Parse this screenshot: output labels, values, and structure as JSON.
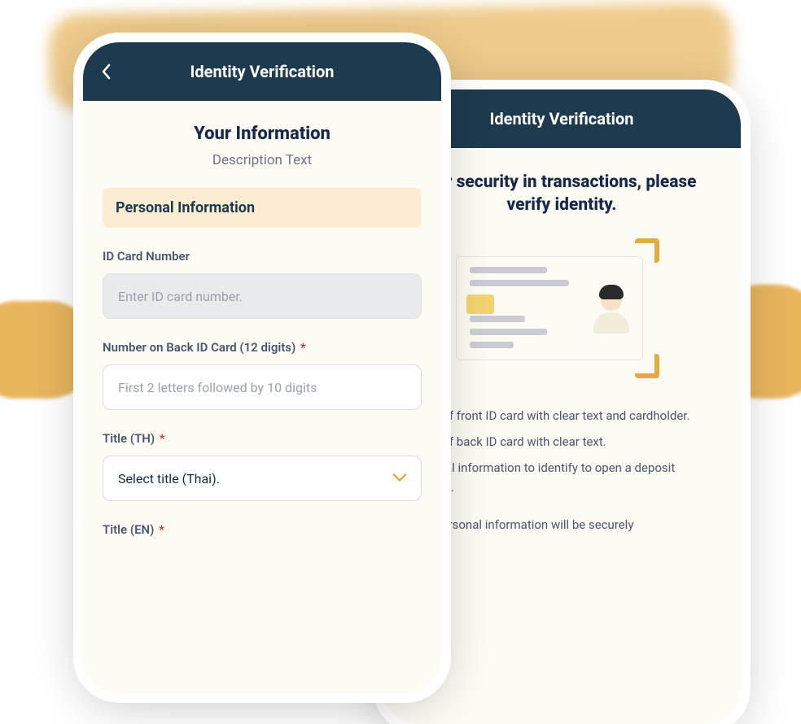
{
  "colors": {
    "accent_gold": "#e4a941",
    "header_bg": "#1e3a4f",
    "text_primary": "#16294a"
  },
  "phone_back": {
    "header_title": "Identity Verification",
    "intro_title": "For security in transactions, please verify identity.",
    "bullets": [
      "Photo of front ID card with clear text and cardholder.",
      "Photo of back ID card with clear text.",
      "Personal information to identify to open a deposit account."
    ],
    "secure_note": "Your personal information will be securely"
  },
  "phone_front": {
    "header_title": "Identity Verification",
    "page_title": "Your Information",
    "page_description": "Description Text",
    "section_title": "Personal Information",
    "fields": {
      "id_card": {
        "label": "ID Card Number",
        "placeholder": "Enter ID card number.",
        "required": false
      },
      "back_id": {
        "label": "Number on Back ID Card (12 digits)",
        "placeholder": "First 2 letters followed by 10 digits",
        "required": true
      },
      "title_th": {
        "label": "Title (TH)",
        "placeholder": "Select title (Thai).",
        "required": true
      },
      "title_en": {
        "label": "Title (EN)",
        "required": true
      }
    },
    "required_marker": "*"
  }
}
